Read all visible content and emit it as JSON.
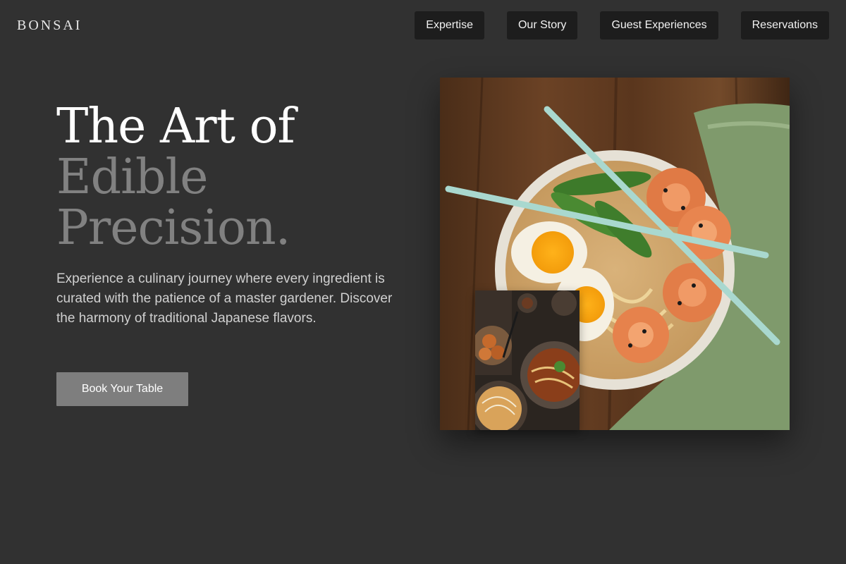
{
  "brand": {
    "name": "BONSAI"
  },
  "nav": {
    "items": [
      {
        "label": "Expertise"
      },
      {
        "label": "Our Story"
      },
      {
        "label": "Guest Experiences"
      },
      {
        "label": "Reservations"
      }
    ]
  },
  "hero": {
    "headline_line_1": "The Art of",
    "headline_line_2": "Edible",
    "headline_line_3": "Precision.",
    "description": "Experience a culinary journey where every ingredient is curated with the patience of a master gardener. Discover the harmony of traditional Japanese flavors.",
    "cta_label": "Book Your Table"
  },
  "images": {
    "main": {
      "icon": "ramen-bowl-photo"
    },
    "inset": {
      "icon": "japanese-dishes-photo"
    }
  },
  "colors": {
    "background": "#313131",
    "nav_button": "#1d1d1d",
    "accent_text": "#818181",
    "cta": "#7e7e7e"
  }
}
